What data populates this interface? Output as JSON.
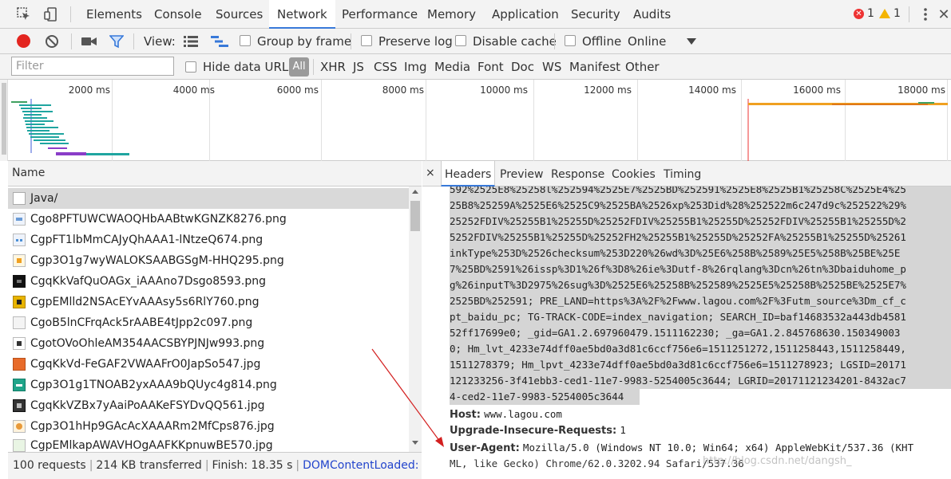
{
  "topbar": {
    "tabs": [
      "Elements",
      "Console",
      "Sources",
      "Network",
      "Performance",
      "Memory",
      "Application",
      "Security",
      "Audits"
    ],
    "error_count": "1",
    "warning_count": "1",
    "accent": "#3879d9"
  },
  "toolbar": {
    "view_label": "View:",
    "group_by_frame": "Group by frame",
    "preserve_log": "Preserve log",
    "disable_cache": "Disable cache",
    "offline": "Offline",
    "throttle": "Online"
  },
  "filter": {
    "placeholder": "Filter",
    "hide_data_urls": "Hide data URLs",
    "types": [
      "All",
      "XHR",
      "JS",
      "CSS",
      "Img",
      "Media",
      "Font",
      "Doc",
      "WS",
      "Manifest",
      "Other"
    ]
  },
  "overview": {
    "ticks": [
      "2000 ms",
      "4000 ms",
      "6000 ms",
      "8000 ms",
      "10000 ms",
      "12000 ms",
      "14000 ms",
      "16000 ms",
      "18000 ms"
    ]
  },
  "list": {
    "header": "Name",
    "rows": [
      {
        "name": "Java/",
        "icon": "document-icon"
      },
      {
        "name": "Cgo8PFTUWCWAOQHbAABtwKGNZK8276.png",
        "icon": "image-icon"
      },
      {
        "name": "CgpFT1lbMmCAJyQhAAA1-lNtzeQ674.png",
        "icon": "image-icon"
      },
      {
        "name": "Cgp3O1g7wyWALOKSAABGSgM-HHQ295.png",
        "icon": "image-icon"
      },
      {
        "name": "CgqKkVafQuOAGx_iAAAno7Dsgo8593.png",
        "icon": "image-icon"
      },
      {
        "name": "CgpEMlld2NSAcEYvAAAsy5s6RlY760.png",
        "icon": "image-icon"
      },
      {
        "name": "CgoB5lnCFrqAck5rAABE4tJpp2c097.png",
        "icon": "image-icon"
      },
      {
        "name": "CgotOVoOhleAM354AACSBYPJNJw993.png",
        "icon": "image-icon"
      },
      {
        "name": "CgqKkVd-FeGAF2VWAAFrO0JapSo547.jpg",
        "icon": "image-icon"
      },
      {
        "name": "Cgp3O1g1TNOAB2yxAAA9bQUyc4g814.png",
        "icon": "image-icon"
      },
      {
        "name": "CgqKkVZBx7yAaiPoAAKeFSYDvQQ561.jpg",
        "icon": "image-icon"
      },
      {
        "name": "Cgp3O1hHp9GAcAcXAAARm2MfCps876.jpg",
        "icon": "image-icon"
      },
      {
        "name": "CgpEMlkapAWAVHOgAAFKKpnuwBE570.jpg",
        "icon": "image-icon"
      }
    ]
  },
  "status": {
    "requests": "100 requests",
    "transferred": "214 KB transferred",
    "finish": "Finish: 18.35 s",
    "dcl": "DOMContentLoaded: ..."
  },
  "detail": {
    "close": "×",
    "tabs": [
      "Headers",
      "Preview",
      "Response",
      "Cookies",
      "Timing"
    ],
    "cookie_lines": [
      "592%2525E8%25258l%252594%2525E7%2525BD%252591%2525E8%2525B1%25258C%2525E4%25",
      "25B8%25259A%2525E6%2525C9%2525BA%2526xp%253Did%28%252522m6c247d9c%252522%29%",
      "25252FDIV%25255B1%25255D%25252FDIV%25255B1%25255D%25252FDIV%25255B1%25255D%2",
      "5252FDIV%25255B1%25255D%25252FH2%25255B1%25255D%25252FA%25255B1%25255D%25261",
      "inkType%253D%2526checksum%253D220%26wd%3D%25E6%258B%2589%25E5%258B%25BE%25E",
      "7%25BD%2591%26issp%3D1%26f%3D8%26ie%3Dutf-8%26rqlang%3Dcn%26tn%3Dbaiduhome_p",
      "g%26inputT%3D2975%26sug%3D%2525E6%25258B%252589%2525E5%25258B%2525BE%2525E7%",
      "2525BD%252591; PRE_LAND=https%3A%2F%2Fwww.lagou.com%2F%3Futm_source%3Dm_cf_c",
      "pt_baidu_pc; TG-TRACK-CODE=index_navigation; SEARCH_ID=baf14683532a443db4581",
      "52ff17699e0; _gid=GA1.2.697960479.1511162230; _ga=GA1.2.845768630.150349003",
      "0; Hm_lvt_4233e74dff0ae5bd0a3d81c6ccf756e6=1511251272,1511258443,1511258449,",
      "1511278379; Hm_lpvt_4233e74dff0ae5bd0a3d81c6ccf756e6=1511278923; LGSID=20171",
      "121233256-3f41ebb3-ced1-11e7-9983-5254005c3644; LGRID=20171121234201-8432ac7",
      "4-ced2-11e7-9983-5254005c3644"
    ],
    "headers": [
      {
        "key": "Host:",
        "value": "www.lagou.com"
      },
      {
        "key": "Upgrade-Insecure-Requests:",
        "value": "1"
      },
      {
        "key": "User-Agent:",
        "value": "Mozilla/5.0 (Windows NT 10.0; Win64; x64) AppleWebKit/537.36 (KHT"
      }
    ],
    "ua_continuation": "ML, like Gecko) Chrome/62.0.3202.94 Safari/537.36"
  },
  "watermark": "http://blog.csdn.net/dangsh_"
}
